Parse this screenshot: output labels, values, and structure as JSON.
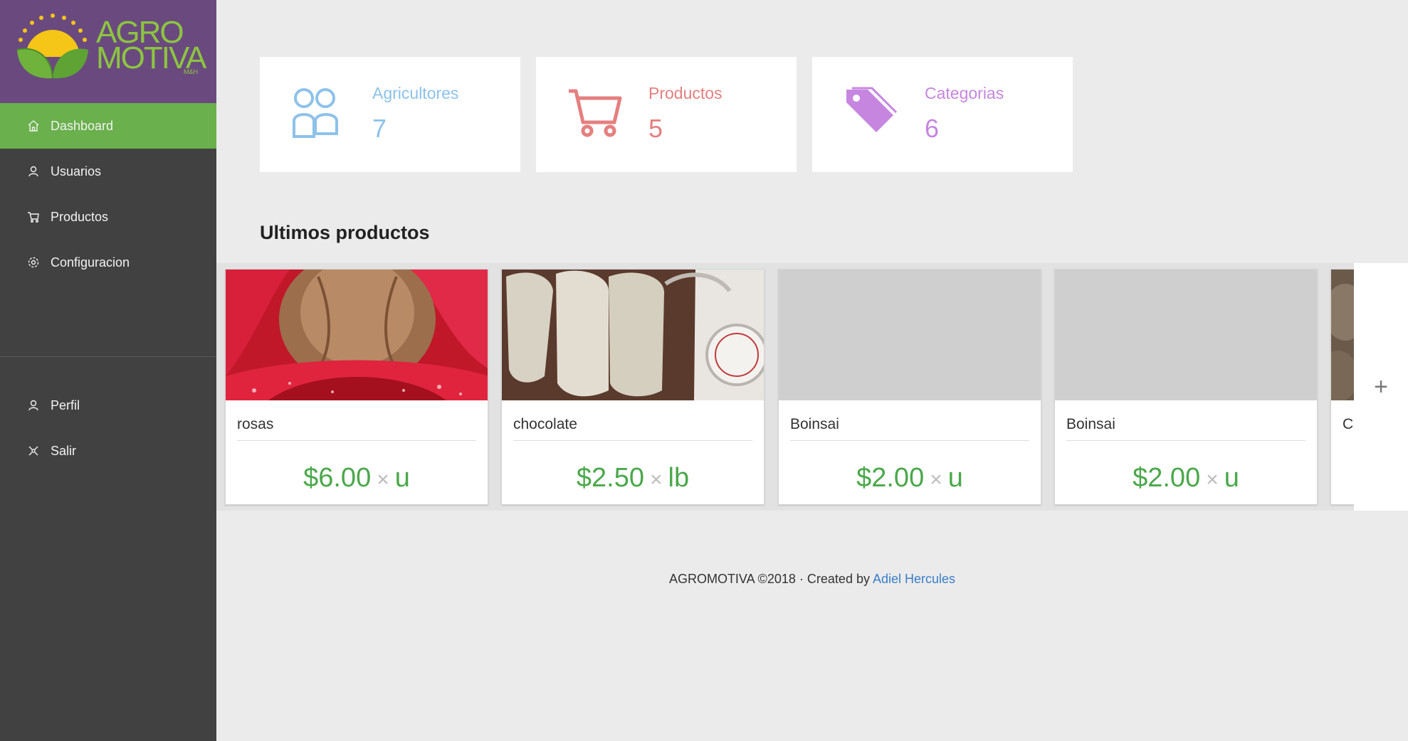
{
  "brand": {
    "line1": "AGRO",
    "line2": "MOTIVA",
    "suffix": "M&H",
    "colors": {
      "purple": "#6a4a7e",
      "green": "#8cc540",
      "sun": "#f5c518"
    }
  },
  "sidebar": {
    "items": [
      {
        "label": "Dashboard",
        "icon": "home-icon",
        "active": true
      },
      {
        "label": "Usuarios",
        "icon": "user-icon"
      },
      {
        "label": "Productos",
        "icon": "cart-icon"
      },
      {
        "label": "Configuracion",
        "icon": "gear-icon"
      }
    ],
    "bottom_items": [
      {
        "label": "Perfil",
        "icon": "user-icon"
      },
      {
        "label": "Salir",
        "icon": "logout-icon"
      }
    ],
    "colors": {
      "bg": "#414141",
      "active": "#6ab04c"
    }
  },
  "stats": [
    {
      "label": "Agricultores",
      "value": "7",
      "icon": "users-icon",
      "color": "#8dc2ea"
    },
    {
      "label": "Productos",
      "value": "5",
      "icon": "cart-icon",
      "color": "#e57f7f"
    },
    {
      "label": "Categorias",
      "value": "6",
      "icon": "tag-icon",
      "color": "#c686e0"
    }
  ],
  "section_title": "Ultimos productos",
  "products": [
    {
      "name": "rosas",
      "price": "$6.00",
      "times": "×",
      "unit": "u",
      "image": "rose-photo"
    },
    {
      "name": "chocolate",
      "price": "$2.50",
      "times": "×",
      "unit": "lb",
      "image": "bags-photo"
    },
    {
      "name": "Boinsai",
      "price": "$2.00",
      "times": "×",
      "unit": "u",
      "image": "placeholder"
    },
    {
      "name": "Boinsai",
      "price": "$2.00",
      "times": "×",
      "unit": "u",
      "image": "placeholder"
    },
    {
      "name": "C",
      "price": "",
      "times": "",
      "unit": "",
      "image": "partial-photo"
    }
  ],
  "add_button": "+",
  "footer": {
    "text": "AGROMOTIVA ©2018 · Created by",
    "link": "Adiel Hercules"
  }
}
